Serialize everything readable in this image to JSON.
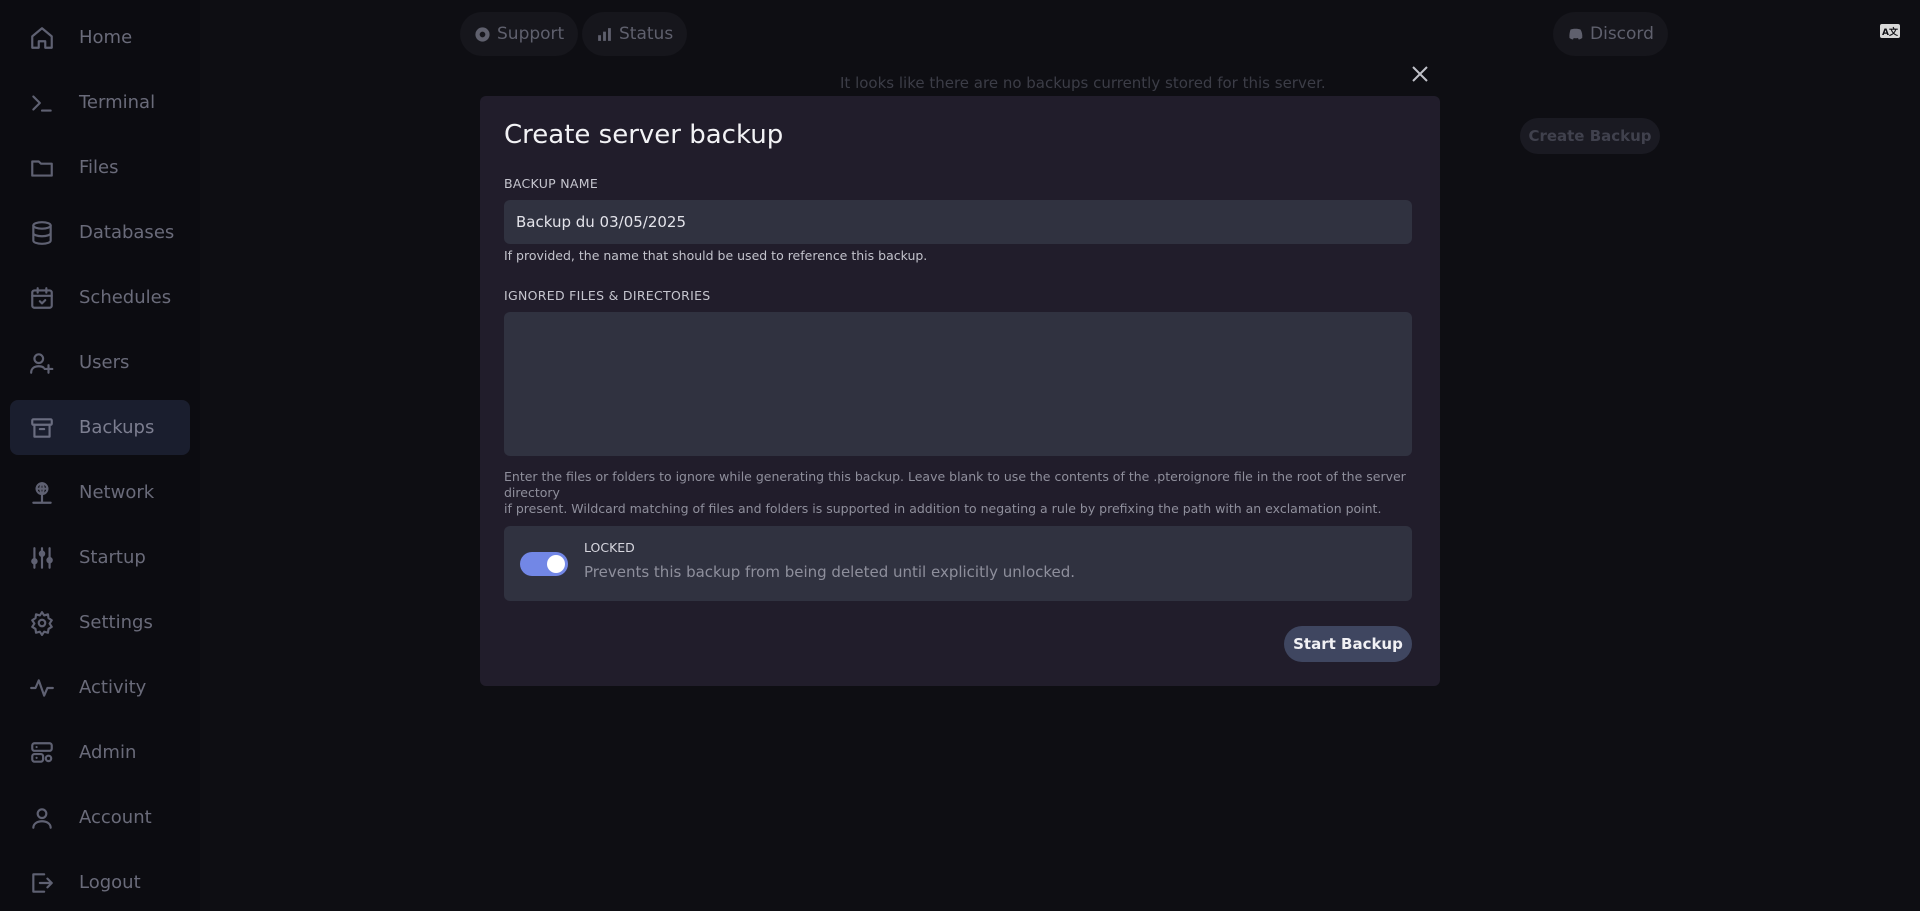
{
  "sidebar": {
    "items": [
      {
        "label": "Home",
        "icon": "home-icon"
      },
      {
        "label": "Terminal",
        "icon": "terminal-icon"
      },
      {
        "label": "Files",
        "icon": "folder-icon"
      },
      {
        "label": "Databases",
        "icon": "database-icon"
      },
      {
        "label": "Schedules",
        "icon": "calendar-icon"
      },
      {
        "label": "Users",
        "icon": "user-plus-icon"
      },
      {
        "label": "Backups",
        "icon": "archive-icon",
        "active": true
      },
      {
        "label": "Network",
        "icon": "network-icon"
      },
      {
        "label": "Startup",
        "icon": "sliders-icon"
      },
      {
        "label": "Settings",
        "icon": "gear-icon"
      },
      {
        "label": "Activity",
        "icon": "activity-icon"
      },
      {
        "label": "Admin",
        "icon": "server-cog-icon"
      },
      {
        "label": "Account",
        "icon": "user-icon"
      },
      {
        "label": "Logout",
        "icon": "logout-icon"
      }
    ]
  },
  "topbar": {
    "support_label": "Support",
    "status_label": "Status",
    "discord_label": "Discord",
    "language_icon": "translate-icon"
  },
  "page": {
    "empty_message": "It looks like there are no backups currently stored for this server.",
    "create_backup_label": "Create Backup"
  },
  "modal": {
    "title": "Create server backup",
    "name_label": "BACKUP NAME",
    "name_value": "Backup du 03/05/2025",
    "name_help": "If provided, the name that should be used to reference this backup.",
    "ignored_label": "IGNORED FILES & DIRECTORIES",
    "ignored_value": "",
    "ignored_help_line1": "Enter the files or folders to ignore while generating this backup. Leave blank to use the contents of the .pteroignore file in the root of the server directory",
    "ignored_help_line2": "if present. Wildcard matching of files and folders is supported in addition to negating a rule by prefixing the path with an exclamation point.",
    "locked_title": "LOCKED",
    "locked_description": "Prevents this backup from being deleted until explicitly unlocked.",
    "locked_enabled": true,
    "submit_label": "Start Backup"
  },
  "colors": {
    "background": "#0e0e13",
    "modal_background": "#211d2b",
    "input_background": "#303240",
    "toggle_on": "#7287e6",
    "button": "#3f4660"
  }
}
